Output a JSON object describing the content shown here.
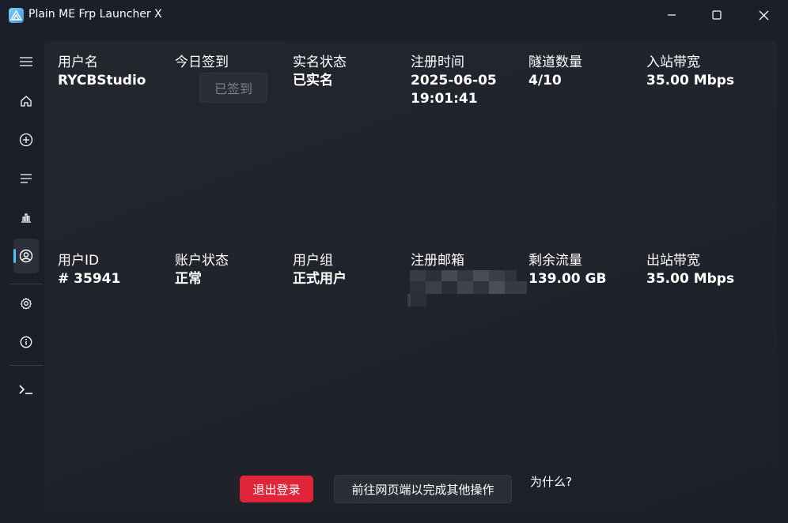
{
  "window": {
    "title": "Plain ME Frp Launcher X"
  },
  "sidebar": {
    "items": [
      {
        "name": "menu",
        "icon": "hamburger-icon"
      },
      {
        "name": "home",
        "icon": "home-icon"
      },
      {
        "name": "add",
        "icon": "add-circle-icon"
      },
      {
        "name": "list",
        "icon": "list-icon"
      },
      {
        "name": "stats",
        "icon": "chart-icon"
      },
      {
        "name": "account",
        "icon": "user-circle-icon",
        "active": true
      },
      {
        "name": "settings",
        "icon": "gear-icon"
      },
      {
        "name": "about",
        "icon": "info-icon"
      },
      {
        "name": "console",
        "icon": "terminal-icon"
      }
    ],
    "accent": "#4cc2ff"
  },
  "account": {
    "row1": [
      {
        "label": "用户名",
        "value": "RYCBStudio"
      },
      {
        "label": "今日签到",
        "value": ""
      },
      {
        "label": "实名状态",
        "value": "已实名"
      },
      {
        "label": "注册时间",
        "value": "2025-06-05",
        "value2": "19:01:41"
      },
      {
        "label": "隧道数量",
        "value": "4/10"
      },
      {
        "label": "入站带宽",
        "value": "35.00 Mbps"
      }
    ],
    "row2": [
      {
        "label": "用户ID",
        "value": "# 35941"
      },
      {
        "label": "账户状态",
        "value": "正常"
      },
      {
        "label": "用户组",
        "value": "正式用户"
      },
      {
        "label": "注册邮箱",
        "value": ""
      },
      {
        "label": "剩余流量",
        "value": "139.00 GB"
      },
      {
        "label": "出站带宽",
        "value": "35.00 Mbps"
      }
    ],
    "signin_button": "已签到"
  },
  "actions": {
    "logout": "退出登录",
    "web": "前往网页端以完成其他操作",
    "why": "为什么?"
  },
  "colors": {
    "background": "#1c1f2a",
    "panel": "#21232c",
    "danger": "#e0243a"
  }
}
